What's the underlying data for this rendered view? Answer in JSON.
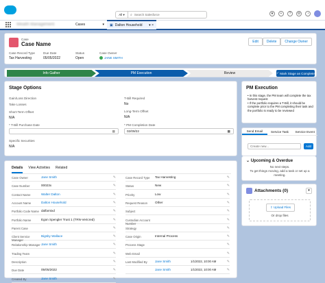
{
  "topbar": {
    "search_scope": "All",
    "search_placeholder": "Search Salesforce"
  },
  "nav": {
    "app_name": "Wealth Management",
    "tabs": [
      {
        "label": "Cases"
      },
      {
        "label": "Dalton Household"
      }
    ]
  },
  "record": {
    "object": "Case",
    "name": "Case Name",
    "buttons": [
      "Edit",
      "Delete",
      "Change Owner"
    ],
    "highlights": [
      {
        "label": "Case Record Type",
        "value": "Tax Harvesting"
      },
      {
        "label": "Due Date",
        "value": "05/05/2022"
      },
      {
        "label": "Status",
        "value": "Open"
      },
      {
        "label": "Case Owner",
        "value": "JANE SMITH"
      }
    ]
  },
  "path": {
    "steps": [
      "Info Gather",
      "PM Execution",
      "Review"
    ],
    "mark_button": "Mark Stage as Complete"
  },
  "stage_options": {
    "title": "Stage Options",
    "left": [
      {
        "label": "Gain/Loss Direction",
        "value": ""
      },
      {
        "label": "Take Losses",
        "value": ""
      },
      {
        "label": "Short-Term Offset",
        "value": "N/A"
      },
      {
        "label": "* T-Bill Purchase Date",
        "value": ""
      },
      {
        "label": "Specific Securities",
        "value": "N/A"
      }
    ],
    "right": [
      {
        "label": "T-Bill Required",
        "value": "No"
      },
      {
        "label": "Long-Term Offset",
        "value": "N/A"
      },
      {
        "label": "* PM Completion Date",
        "value": "02/09/22"
      }
    ]
  },
  "pm_execution": {
    "title": "PM Execution",
    "bullets": [
      "In this stage, the PM team will complete the tax harvest request",
      "If the portfolio requires a T-Bill, it should be complete prior to the PM completing their task and the portfolio is ready to be reviewed"
    ]
  },
  "activity": {
    "tabs": [
      "Send Email",
      "Service Task",
      "Service Event"
    ],
    "placeholder": "Create new...",
    "add": "Add",
    "upcoming": "Upcoming & Overdue",
    "no_steps": "No next steps.",
    "hint": "To get things moving, add a task or set up a meeting."
  },
  "attachments": {
    "title": "Attachments (0)",
    "upload": "Upload Files",
    "drop": "Or drop files"
  },
  "details": {
    "tabs": [
      "Details",
      "View Activities",
      "Related"
    ],
    "left": [
      {
        "label": "Case Owner",
        "value": "Jane Smith",
        "link": true
      },
      {
        "label": "Case Number",
        "value": "00023x",
        "link": false
      },
      {
        "label": "Contact Name",
        "value": "Walter Dalton",
        "link": true
      },
      {
        "label": "Account Name",
        "value": "Dalton Household",
        "link": true
      },
      {
        "label": "Portfolio Code Name",
        "value": "dalfamtxd",
        "link": false
      },
      {
        "label": "Portfolio Name",
        "value": "Egon Spengler Trust 1 (TRN-Vericred)",
        "link": false
      },
      {
        "label": "Parent Case",
        "value": "",
        "link": false
      },
      {
        "label": "Client Service Manager",
        "value": "Bigsby Wallace",
        "link": true
      },
      {
        "label": "Relationship Manager",
        "value": "Jane Smith",
        "link": true
      },
      {
        "label": "Trading Team",
        "value": "",
        "link": false
      },
      {
        "label": "Description",
        "value": "",
        "link": false
      },
      {
        "label": "Due Date",
        "value": "05/05/2022",
        "link": false
      },
      {
        "label": "Created By",
        "value": "Jane Smith",
        "link": true
      }
    ],
    "right": [
      {
        "label": "Case Record Type",
        "value": "Tax Harvesting",
        "link": false
      },
      {
        "label": "Status",
        "value": "New",
        "link": false
      },
      {
        "label": "Priority",
        "value": "Low",
        "link": false
      },
      {
        "label": "Request Reason",
        "value": "Other",
        "link": false
      },
      {
        "label": "Subject",
        "value": "",
        "link": false
      },
      {
        "label": "Custodian Account Number",
        "value": "",
        "link": false
      },
      {
        "label": "Strategy",
        "value": "",
        "link": false
      },
      {
        "label": "Case Origin",
        "value": "Internal Process",
        "link": false
      },
      {
        "label": "Process Stage",
        "value": "",
        "link": false
      },
      {
        "label": "Web Email",
        "value": "",
        "link": false
      },
      {
        "label": "Last Modified By",
        "value": "Jane Smith",
        "link": true,
        "suffix": "1/1/2022, 10:00 AM"
      },
      {
        "label": "",
        "value": "Jane Smith",
        "link": true,
        "suffix": "1/1/2022, 10:00 AM"
      }
    ]
  }
}
